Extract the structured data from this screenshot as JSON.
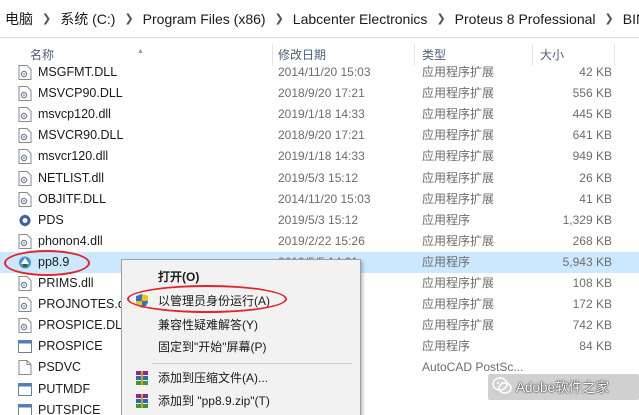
{
  "address_bar": {
    "crumbs": [
      "电脑",
      "系统 (C:)",
      "Program Files (x86)",
      "Labcenter Electronics",
      "Proteus 8 Professional",
      "BIN"
    ]
  },
  "columns": {
    "name": "名称",
    "date": "修改日期",
    "type": "类型",
    "size": "大小"
  },
  "files": [
    {
      "name": "MSGFMT.DLL",
      "date": "2014/11/20 15:03",
      "type": "应用程序扩展",
      "size": "42 KB",
      "icon": "dll-icon"
    },
    {
      "name": "MSVCP90.DLL",
      "date": "2018/9/20 17:21",
      "type": "应用程序扩展",
      "size": "556 KB",
      "icon": "dll-icon"
    },
    {
      "name": "msvcp120.dll",
      "date": "2019/1/18 14:33",
      "type": "应用程序扩展",
      "size": "445 KB",
      "icon": "dll-icon"
    },
    {
      "name": "MSVCR90.DLL",
      "date": "2018/9/20 17:21",
      "type": "应用程序扩展",
      "size": "641 KB",
      "icon": "dll-icon"
    },
    {
      "name": "msvcr120.dll",
      "date": "2019/1/18 14:33",
      "type": "应用程序扩展",
      "size": "949 KB",
      "icon": "dll-icon"
    },
    {
      "name": "NETLIST.dll",
      "date": "2019/5/3 15:12",
      "type": "应用程序扩展",
      "size": "26 KB",
      "icon": "dll-icon"
    },
    {
      "name": "OBJITF.DLL",
      "date": "2014/11/20 15:03",
      "type": "应用程序扩展",
      "size": "41 KB",
      "icon": "dll-icon"
    },
    {
      "name": "PDS",
      "date": "2019/5/3 15:12",
      "type": "应用程序",
      "size": "1,329 KB",
      "icon": "pds-app-icon"
    },
    {
      "name": "phonon4.dll",
      "date": "2019/2/22 15:26",
      "type": "应用程序扩展",
      "size": "268 KB",
      "icon": "dll-icon"
    },
    {
      "name": "pp8.9",
      "date": "2019/5/5 14:21",
      "type": "应用程序",
      "size": "5,943 KB",
      "icon": "pp-app-icon"
    },
    {
      "name": "PRIMS.dll",
      "date": "",
      "type": "应用程序扩展",
      "size": "108 KB",
      "icon": "dll-icon"
    },
    {
      "name": "PROJNOTES.dll",
      "date": "",
      "type": "应用程序扩展",
      "size": "172 KB",
      "icon": "dll-icon"
    },
    {
      "name": "PROSPICE.DLL",
      "date": "",
      "type": "应用程序扩展",
      "size": "742 KB",
      "icon": "dll-icon"
    },
    {
      "name": "PROSPICE",
      "date": "",
      "type": "应用程序",
      "size": "84 KB",
      "icon": "app-window-icon"
    },
    {
      "name": "PSDVC",
      "date": "",
      "type": "AutoCAD PostSc...",
      "size": "",
      "icon": "file-icon"
    },
    {
      "name": "PUTMDF",
      "date": "",
      "type": "",
      "size": "",
      "icon": "app-window-icon"
    },
    {
      "name": "PUTSPICE",
      "date": "",
      "type": "",
      "size": "",
      "icon": "app-window-icon"
    }
  ],
  "context_menu": {
    "items": [
      {
        "label": "打开(O)",
        "bold": true
      },
      {
        "label": "以管理员身份运行(A)",
        "icon": "shield-icon"
      },
      {
        "label": "兼容性疑难解答(Y)"
      },
      {
        "label": "固定到\"开始\"屏幕(P)"
      },
      {
        "label": "添加到压缩文件(A)...",
        "icon": "winrar-icon"
      },
      {
        "label": "添加到 \"pp8.9.zip\"(T)",
        "icon": "winrar-icon"
      }
    ]
  },
  "watermark": {
    "text": "Adobe软件之家"
  },
  "colors": {
    "selection": "#cce8ff",
    "annotation": "#e0262b",
    "header_text": "#4c607a"
  }
}
